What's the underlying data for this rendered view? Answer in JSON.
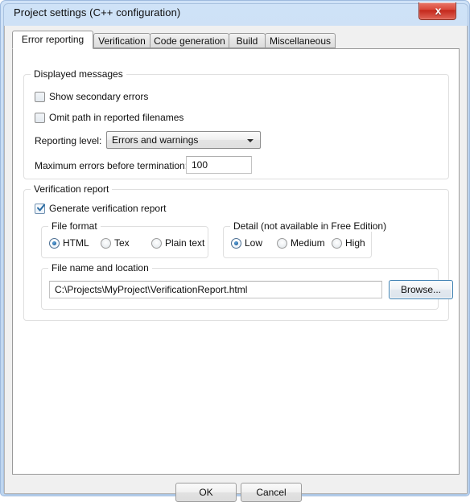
{
  "window": {
    "title": "Project settings (C++ configuration)",
    "close_glyph": "x"
  },
  "tabs": [
    {
      "label": "Error reporting",
      "active": true
    },
    {
      "label": "Verification",
      "active": false
    },
    {
      "label": "Code generation",
      "active": false
    },
    {
      "label": "Build",
      "active": false
    },
    {
      "label": "Miscellaneous",
      "active": false
    }
  ],
  "displayed_messages": {
    "group_title": "Displayed messages",
    "show_secondary_errors": {
      "label": "Show secondary errors",
      "checked": false
    },
    "omit_path": {
      "label": "Omit path in reported filenames",
      "checked": false
    },
    "reporting_level": {
      "label": "Reporting level:",
      "value": "Errors and warnings",
      "options": [
        "Errors and warnings"
      ]
    },
    "max_errors": {
      "label": "Maximum errors before termination:",
      "value": "100"
    }
  },
  "verification_report": {
    "group_title": "Verification report",
    "generate": {
      "label": "Generate verification report",
      "checked": true
    },
    "file_format": {
      "group_title": "File format",
      "options": [
        {
          "label": "HTML",
          "selected": true
        },
        {
          "label": "Tex",
          "selected": false
        },
        {
          "label": "Plain text",
          "selected": false
        }
      ]
    },
    "detail": {
      "group_title": "Detail (not available in Free Edition)",
      "options": [
        {
          "label": "Low",
          "selected": true
        },
        {
          "label": "Medium",
          "selected": false
        },
        {
          "label": "High",
          "selected": false
        }
      ]
    },
    "file_location": {
      "group_title": "File name and location",
      "path": "C:\\Projects\\MyProject\\VerificationReport.html",
      "browse_label": "Browse..."
    }
  },
  "footer": {
    "ok_label": "OK",
    "cancel_label": "Cancel"
  },
  "colors": {
    "titlebar": "#bfd8f2",
    "close_button": "#c4281c",
    "accent_focus": "#3c7fb1",
    "panel": "#f0f0f0"
  }
}
